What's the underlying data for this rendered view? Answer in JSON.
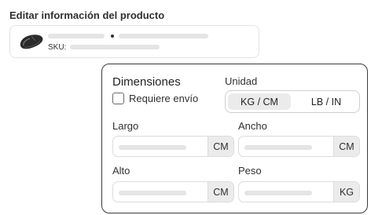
{
  "page": {
    "title": "Editar información del producto"
  },
  "product": {
    "sku_label": "SKU:",
    "thumbnail_icon": "mouse-icon"
  },
  "dimensions": {
    "title": "Dimensiones",
    "requires_shipping": {
      "label": "Requiere envío",
      "checked": false
    },
    "unit": {
      "label": "Unidad",
      "options": [
        "KG / CM",
        "LB / IN"
      ],
      "selected": "KG / CM"
    },
    "fields": {
      "length": {
        "label": "Largo",
        "suffix": "CM"
      },
      "width": {
        "label": "Ancho",
        "suffix": "CM"
      },
      "height": {
        "label": "Alto",
        "suffix": "CM"
      },
      "weight": {
        "label": "Peso",
        "suffix": "KG"
      }
    }
  }
}
